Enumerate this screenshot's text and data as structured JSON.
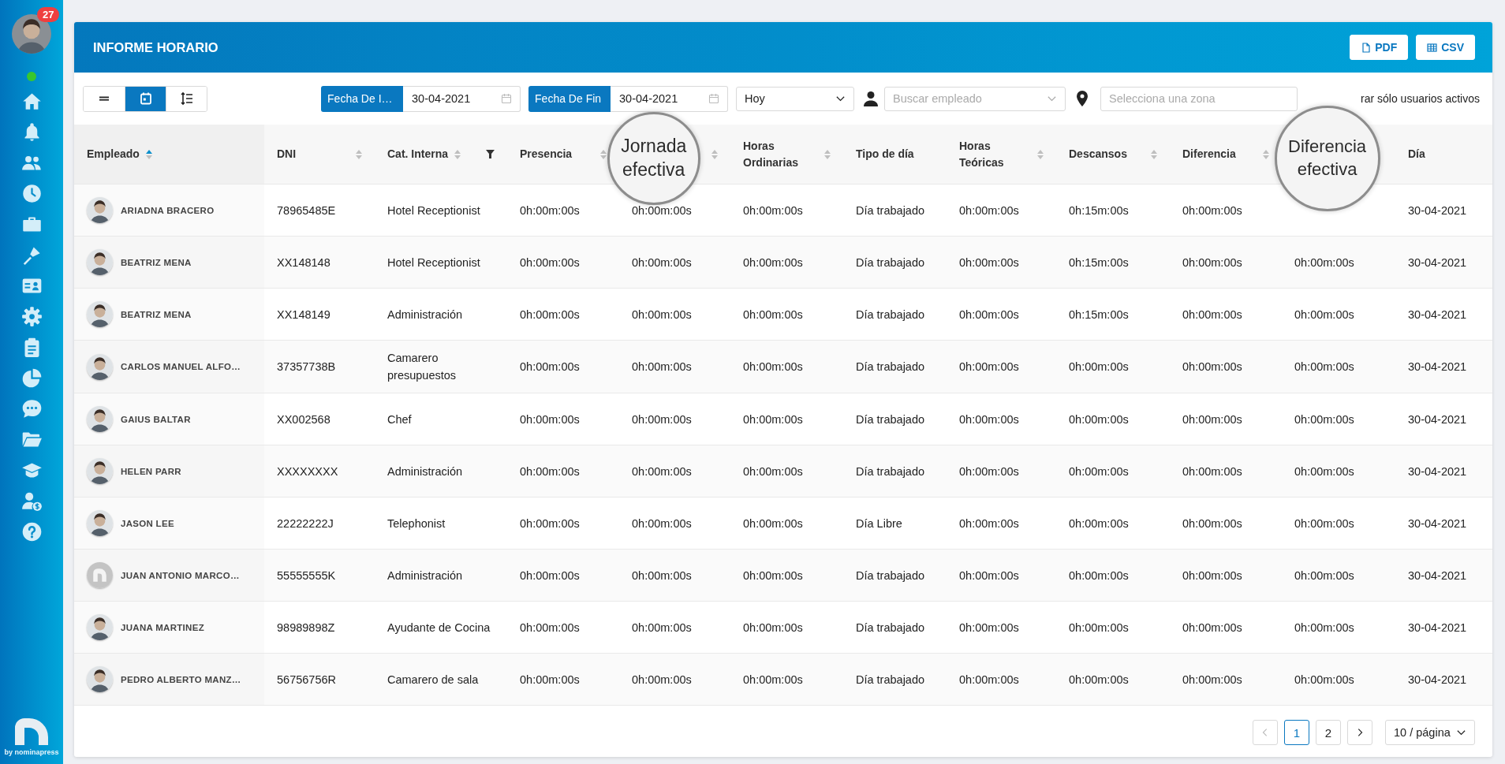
{
  "sidebar": {
    "badge": "27",
    "online": true,
    "items": [
      {
        "kind": "home"
      },
      {
        "kind": "bell"
      },
      {
        "kind": "users"
      },
      {
        "kind": "clock"
      },
      {
        "kind": "briefcase"
      },
      {
        "kind": "broom"
      },
      {
        "kind": "id-card"
      },
      {
        "kind": "gear"
      },
      {
        "kind": "clipboard"
      },
      {
        "kind": "pie"
      },
      {
        "kind": "chat"
      },
      {
        "kind": "folder"
      },
      {
        "kind": "cap"
      },
      {
        "kind": "user-dollar"
      },
      {
        "kind": "help"
      }
    ],
    "brand": "by nominapress"
  },
  "report": {
    "title": "INFORME HORARIO",
    "exports": [
      {
        "kind": "pdf",
        "label": "PDF"
      },
      {
        "kind": "csv",
        "label": "CSV"
      }
    ]
  },
  "toolbar": {
    "views": [
      {
        "kind": "lines",
        "selected": false
      },
      {
        "kind": "calendar",
        "selected": true
      },
      {
        "kind": "list",
        "selected": false
      }
    ],
    "date_from": {
      "label": "Fecha De I…",
      "value": "30-04-2021"
    },
    "date_to": {
      "label": "Fecha De Fin",
      "value": "30-04-2021"
    },
    "period": {
      "value": "Hoy"
    },
    "employee": {
      "placeholder": "Buscar empleado"
    },
    "zone": {
      "placeholder": "Selecciona una zona"
    },
    "active_only": "rar sólo usuarios activos"
  },
  "table": {
    "columns": [
      {
        "label": "Empleado",
        "sortable": true,
        "sorted": true,
        "filterable": false,
        "magnified": false
      },
      {
        "label": "DNI",
        "sortable": true,
        "sorted": false,
        "filterable": false,
        "magnified": false
      },
      {
        "label": "Cat. Interna",
        "sortable": true,
        "sorted": false,
        "filterable": true,
        "magnified": false
      },
      {
        "label": "Presencia",
        "sortable": true,
        "sorted": false,
        "filterable": false,
        "magnified": false
      },
      {
        "label": "Jornada efectiva",
        "sortable": true,
        "sorted": false,
        "filterable": false,
        "magnified": true
      },
      {
        "label": "Horas Ordinarias",
        "sortable": true,
        "sorted": false,
        "filterable": false,
        "magnified": false
      },
      {
        "label": "Tipo de día",
        "sortable": false,
        "filterable": false,
        "magnified": false
      },
      {
        "label": "Horas Teóricas",
        "sortable": true,
        "sorted": false,
        "filterable": false,
        "magnified": false
      },
      {
        "label": "Descansos",
        "sortable": true,
        "sorted": false,
        "filterable": false,
        "magnified": false
      },
      {
        "label": "Diferencia",
        "sortable": true,
        "sorted": false,
        "filterable": false,
        "magnified": false
      },
      {
        "label": "Diferencia efectiva",
        "sortable": false,
        "filterable": false,
        "magnified": true
      },
      {
        "label": "Día",
        "sortable": false,
        "filterable": false,
        "magnified": false
      }
    ],
    "rows": [
      {
        "has_photo": true,
        "cells": [
          "ARIADNA BRACERO",
          "78965485E",
          "Hotel Receptionist",
          "0h:00m:00s",
          "0h:00m:00s",
          "0h:00m:00s",
          "Día trabajado",
          "0h:00m:00s",
          "0h:15m:00s",
          "0h:00m:00s",
          "",
          "30-04-2021"
        ]
      },
      {
        "has_photo": true,
        "cells": [
          "BEATRIZ MENA",
          "XX148148",
          "Hotel Receptionist",
          "0h:00m:00s",
          "0h:00m:00s",
          "0h:00m:00s",
          "Día trabajado",
          "0h:00m:00s",
          "0h:15m:00s",
          "0h:00m:00s",
          "0h:00m:00s",
          "30-04-2021"
        ]
      },
      {
        "has_photo": true,
        "cells": [
          "BEATRIZ MENA",
          "XX148149",
          "Administración",
          "0h:00m:00s",
          "0h:00m:00s",
          "0h:00m:00s",
          "Día trabajado",
          "0h:00m:00s",
          "0h:15m:00s",
          "0h:00m:00s",
          "0h:00m:00s",
          "30-04-2021"
        ]
      },
      {
        "has_photo": true,
        "cells": [
          "CARLOS MANUEL ALFO…",
          "37357738B",
          "Camarero presupuestos",
          "0h:00m:00s",
          "0h:00m:00s",
          "0h:00m:00s",
          "Día trabajado",
          "0h:00m:00s",
          "0h:00m:00s",
          "0h:00m:00s",
          "0h:00m:00s",
          "30-04-2021"
        ]
      },
      {
        "has_photo": true,
        "cells": [
          "GAIUS BALTAR",
          "XX002568",
          "Chef",
          "0h:00m:00s",
          "0h:00m:00s",
          "0h:00m:00s",
          "Día trabajado",
          "0h:00m:00s",
          "0h:00m:00s",
          "0h:00m:00s",
          "0h:00m:00s",
          "30-04-2021"
        ]
      },
      {
        "has_photo": true,
        "cells": [
          "HELEN PARR",
          "XXXXXXXX",
          "Administración",
          "0h:00m:00s",
          "0h:00m:00s",
          "0h:00m:00s",
          "Día trabajado",
          "0h:00m:00s",
          "0h:00m:00s",
          "0h:00m:00s",
          "0h:00m:00s",
          "30-04-2021"
        ]
      },
      {
        "has_photo": true,
        "cells": [
          "JASON LEE",
          "22222222J",
          "Telephonist",
          "0h:00m:00s",
          "0h:00m:00s",
          "0h:00m:00s",
          "Día Libre",
          "0h:00m:00s",
          "0h:00m:00s",
          "0h:00m:00s",
          "0h:00m:00s",
          "30-04-2021"
        ]
      },
      {
        "has_photo": false,
        "cells": [
          "JUAN ANTONIO MARCO…",
          "55555555K",
          "Administración",
          "0h:00m:00s",
          "0h:00m:00s",
          "0h:00m:00s",
          "Día trabajado",
          "0h:00m:00s",
          "0h:00m:00s",
          "0h:00m:00s",
          "0h:00m:00s",
          "30-04-2021"
        ]
      },
      {
        "has_photo": true,
        "cells": [
          "JUANA MARTINEZ",
          "98989898Z",
          "Ayudante de Cocina",
          "0h:00m:00s",
          "0h:00m:00s",
          "0h:00m:00s",
          "Día trabajado",
          "0h:00m:00s",
          "0h:00m:00s",
          "0h:00m:00s",
          "0h:00m:00s",
          "30-04-2021"
        ]
      },
      {
        "has_photo": true,
        "cells": [
          "PEDRO ALBERTO MANZ…",
          "56756756R",
          "Camarero de sala",
          "0h:00m:00s",
          "0h:00m:00s",
          "0h:00m:00s",
          "Día trabajado",
          "0h:00m:00s",
          "0h:00m:00s",
          "0h:00m:00s",
          "0h:00m:00s",
          "30-04-2021"
        ]
      }
    ]
  },
  "pagination": {
    "prev": {
      "disabled": true
    },
    "pages": [
      {
        "label": "1",
        "selected": true
      },
      {
        "label": "2",
        "selected": false
      }
    ],
    "next": {
      "disabled": false
    },
    "page_size": "10 / página"
  }
}
